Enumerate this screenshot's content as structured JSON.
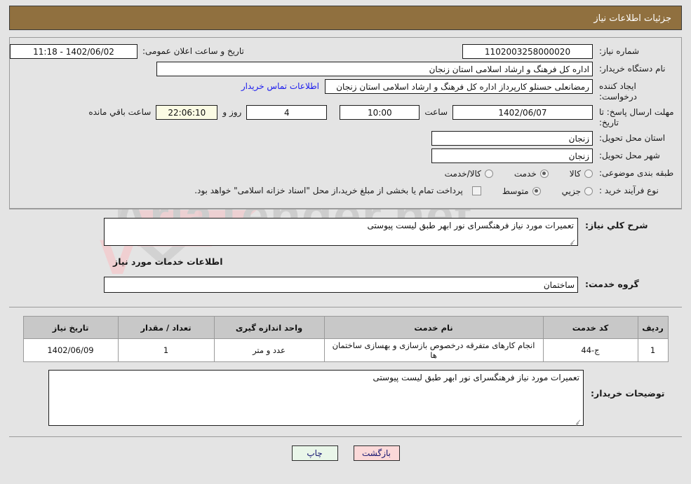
{
  "header": {
    "title": "جزئیات اطلاعات نیاز"
  },
  "form": {
    "need_number_label": "شماره نیاز:",
    "need_number_value": "1102003258000020",
    "announce_label": "تاریخ و ساعت اعلان عمومی:",
    "announce_value": "1402/06/02 - 11:18",
    "buyer_org_label": "نام دستگاه خریدار:",
    "buyer_org_value": "اداره کل فرهنگ و ارشاد اسلامی استان زنجان",
    "creator_label": "ایجاد کننده درخواست:",
    "creator_value": "رمضانعلی حسنلو کارپرداز اداره کل فرهنگ و ارشاد اسلامی استان زنجان",
    "contact_link": "اطلاعات تماس خریدار",
    "deadline_label": "مهلت ارسال پاسخ: تا تاریخ:",
    "deadline_date": "1402/06/07",
    "hour_label": "ساعت",
    "hour_value": "10:00",
    "days_value": "4",
    "days_label": "روز و",
    "countdown_value": "22:06:10",
    "countdown_label": "ساعت باقي مانده",
    "province_label": "استان محل تحویل:",
    "province_value": "زنجان",
    "city_label": "شهر محل تحویل:",
    "city_value": "زنجان",
    "category_label": "طبقه بندی موضوعی:",
    "category_options": [
      {
        "label": "کالا",
        "selected": false
      },
      {
        "label": "خدمت",
        "selected": true
      },
      {
        "label": "کالا/خدمت",
        "selected": false
      }
    ],
    "process_label": "نوع فرآیند خرید :",
    "process_options": [
      {
        "label": "جزیي",
        "selected": false
      },
      {
        "label": "متوسط",
        "selected": true
      }
    ],
    "treasury_checkbox_checked": false,
    "treasury_text": "پرداخت تمام یا بخشی از مبلغ خرید،از محل \"اسناد خزانه اسلامی\" خواهد بود."
  },
  "general": {
    "description_label": "شرح کلي نیاز:",
    "description_value": "تعمیرات مورد نیاز فرهنگسرای نور ابهر طبق لیست پیوستی",
    "services_section_title": "اطلاعات خدمات مورد نیاز",
    "service_group_label": "گروه خدمت:",
    "service_group_value": "ساختمان"
  },
  "table": {
    "columns": [
      "ردیف",
      "کد خدمت",
      "نام خدمت",
      "واحد اندازه گیری",
      "تعداد / مقدار",
      "تاریخ نیاز"
    ],
    "rows": [
      {
        "index": "1",
        "service_code": "ج-44",
        "service_name": "انجام کارهای متفرقه درخصوص بازسازی و بهسازی ساختمان ها",
        "unit": "عدد و متر",
        "quantity": "1",
        "need_date": "1402/06/09"
      }
    ]
  },
  "buyer_notes": {
    "label": "توضیحات خریدار:",
    "value": "تعمیرات مورد نیاز فرهنگسرای نور ابهر طبق لیست پیوستی"
  },
  "footer": {
    "back_label": "بازگشت",
    "print_label": "چاپ"
  },
  "watermark": {
    "text": "AriaTender.net"
  },
  "colors": {
    "header_bg": "#90703f",
    "page_bg": "#e4e4e4",
    "link": "#1a1aee",
    "back_btn": "#fbd9d9",
    "print_btn": "#e9f6e9",
    "table_header": "#c8c8c8",
    "countdown_bg": "#fbfbe4"
  }
}
